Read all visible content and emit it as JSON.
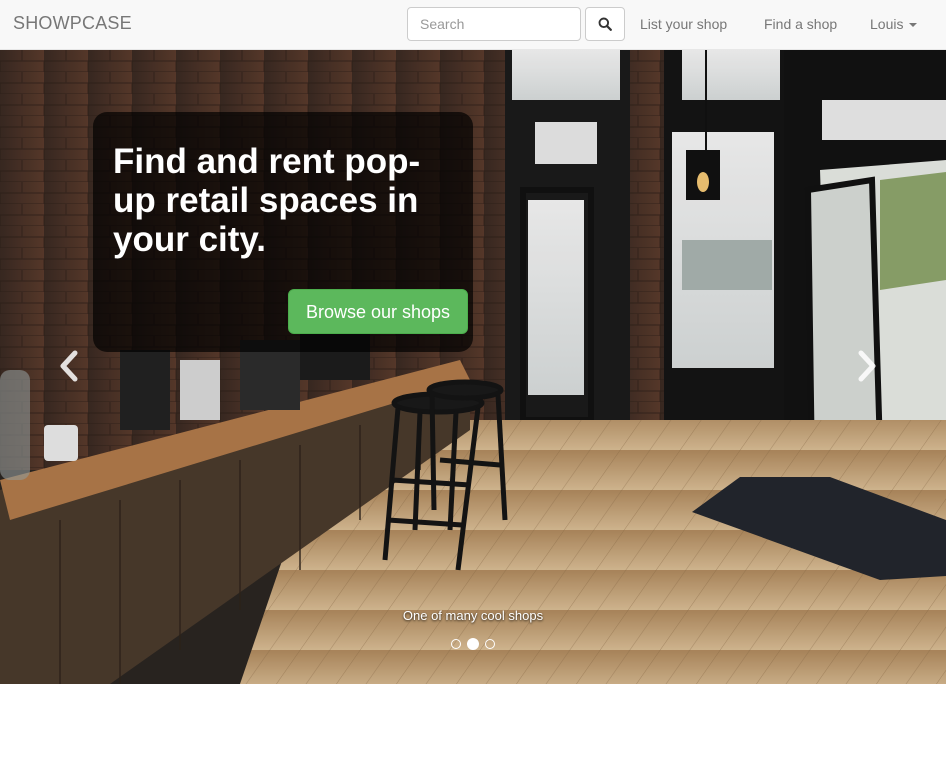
{
  "navbar": {
    "brand": "SHOWPCASE",
    "search": {
      "placeholder": "Search"
    },
    "links": [
      {
        "label": "List your shop"
      },
      {
        "label": "Find a shop"
      }
    ],
    "user": {
      "label": "Louis"
    }
  },
  "hero": {
    "headline": "Find and rent pop-up retail spaces in your city.",
    "cta_label": "Browse our shops",
    "slide_caption": "One of many cool shops",
    "active_slide": 2,
    "slide_count": 3
  },
  "colors": {
    "cta": "#5cb85c",
    "navbar_bg": "#f8f8f8",
    "text_muted": "#777777"
  },
  "icons": [
    "search-icon",
    "chevron-left-icon",
    "chevron-right-icon",
    "caret-down-icon"
  ]
}
